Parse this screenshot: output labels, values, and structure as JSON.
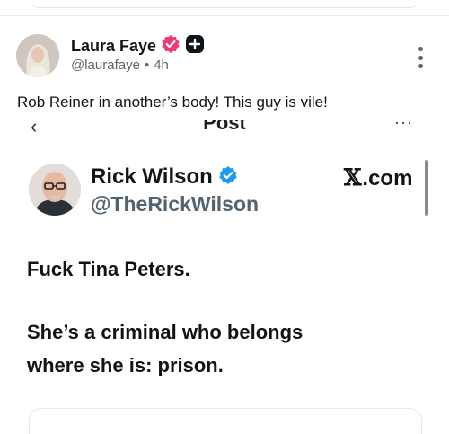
{
  "post": {
    "author_name": "Laura Faye",
    "author_handle": "@laurafaye",
    "separator": "•",
    "timestamp": "4h",
    "text": "Rob Reiner in another’s body! This guy is vile!"
  },
  "embed": {
    "nav_title": "Post",
    "back_glyph": "‹",
    "more_glyph": "···",
    "author_name": "Rick Wilson",
    "author_handle": "@TheRickWilson",
    "source_label": ".com",
    "lines": [
      "Fuck Tina Peters.",
      "She’s a criminal who belongs",
      "where she is: prison."
    ]
  },
  "icons": {
    "verified_badge": "verified-badge-icon",
    "subscriber_badge": "subscriber-plus-icon",
    "more_options": "more-vertical-icon",
    "x_logo": "x-logo-icon"
  },
  "colors": {
    "verified_pink": "#ee3b74",
    "verified_blue": "#1d9bf0",
    "text_primary": "#0f1419",
    "text_secondary": "#536471"
  }
}
